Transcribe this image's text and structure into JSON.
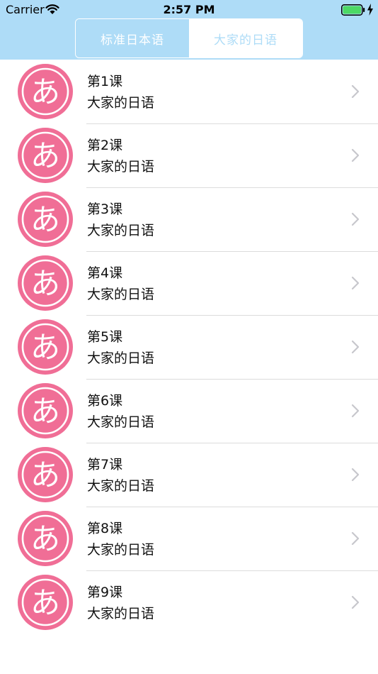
{
  "status_bar": {
    "carrier": "Carrier",
    "time": "2:57 PM",
    "battery_color": "#4cd964"
  },
  "segmented_control": {
    "left_label": "标准日本语",
    "right_label": "大家的日语",
    "selected": "right"
  },
  "colors": {
    "header_bg": "#aedcf7",
    "badge_pink": "#f06e96"
  },
  "lessons": [
    {
      "title": "第1课",
      "subtitle": "大家的日语",
      "icon": "hiragana-a-icon"
    },
    {
      "title": "第2课",
      "subtitle": "大家的日语",
      "icon": "hiragana-a-icon"
    },
    {
      "title": "第3课",
      "subtitle": "大家的日语",
      "icon": "hiragana-a-icon"
    },
    {
      "title": "第4课",
      "subtitle": "大家的日语",
      "icon": "hiragana-a-icon"
    },
    {
      "title": "第5课",
      "subtitle": "大家的日语",
      "icon": "hiragana-a-icon"
    },
    {
      "title": "第6课",
      "subtitle": "大家的日语",
      "icon": "hiragana-a-icon"
    },
    {
      "title": "第7课",
      "subtitle": "大家的日语",
      "icon": "hiragana-a-icon"
    },
    {
      "title": "第8课",
      "subtitle": "大家的日语",
      "icon": "hiragana-a-icon"
    },
    {
      "title": "第9课",
      "subtitle": "大家的日语",
      "icon": "hiragana-a-icon"
    }
  ],
  "badge_glyph": "あ"
}
